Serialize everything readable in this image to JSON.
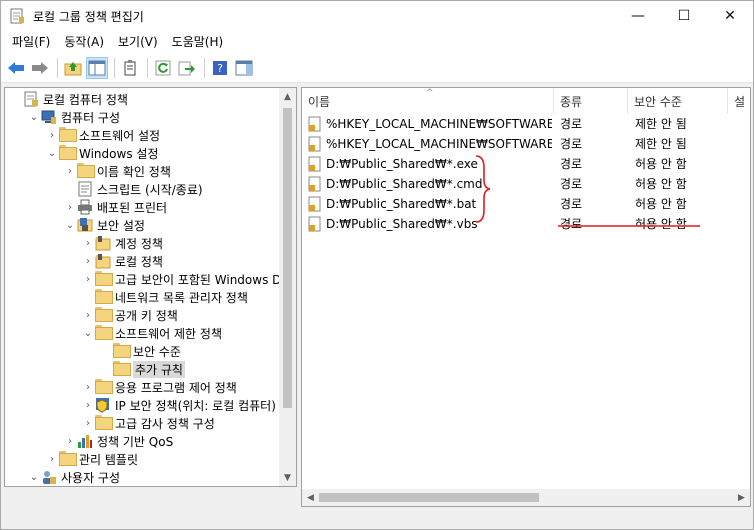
{
  "window": {
    "title": "로컬 그룹 정책 편집기",
    "controls": {
      "minimize": "—",
      "maximize": "☐",
      "close": "✕"
    }
  },
  "menu": [
    "파일(F)",
    "동작(A)",
    "보기(V)",
    "도움말(H)"
  ],
  "toolbar": [
    "back-icon",
    "forward-icon",
    "up-folder-icon",
    "show-hide-tree-icon",
    "properties-icon",
    "refresh-icon",
    "export-list-icon",
    "help-icon",
    "show-action-pane-icon"
  ],
  "tree": [
    {
      "label": "로컬 컴퓨터 정책",
      "depth": 0,
      "arrow": "",
      "icon": "policy-icon"
    },
    {
      "label": "컴퓨터 구성",
      "depth": 1,
      "arrow": "v",
      "icon": "computer-icon"
    },
    {
      "label": "소프트웨어 설정",
      "depth": 2,
      "arrow": ">",
      "icon": "folder-icon"
    },
    {
      "label": "Windows 설정",
      "depth": 2,
      "arrow": "v",
      "icon": "folder-icon"
    },
    {
      "label": "이름 확인 정책",
      "depth": 3,
      "arrow": ">",
      "icon": "folder-icon"
    },
    {
      "label": "스크립트 (시작/종료)",
      "depth": 3,
      "arrow": "",
      "icon": "script-icon"
    },
    {
      "label": "배포된 프린터",
      "depth": 3,
      "arrow": ">",
      "icon": "printer-icon"
    },
    {
      "label": "보안 설정",
      "depth": 3,
      "arrow": "v",
      "icon": "security-icon"
    },
    {
      "label": "계정 정책",
      "depth": 4,
      "arrow": ">",
      "icon": "locked-folder-icon"
    },
    {
      "label": "로컬 정책",
      "depth": 4,
      "arrow": ">",
      "icon": "locked-folder-icon"
    },
    {
      "label": "고급 보안이 포함된 Windows Defender 방화벽",
      "depth": 4,
      "arrow": ">",
      "icon": "folder-icon"
    },
    {
      "label": "네트워크 목록 관리자 정책",
      "depth": 4,
      "arrow": "",
      "icon": "folder-icon"
    },
    {
      "label": "공개 키 정책",
      "depth": 4,
      "arrow": ">",
      "icon": "folder-icon"
    },
    {
      "label": "소프트웨어 제한 정책",
      "depth": 4,
      "arrow": "v",
      "icon": "folder-icon"
    },
    {
      "label": "보안 수준",
      "depth": 5,
      "arrow": "",
      "icon": "folder-icon"
    },
    {
      "label": "추가 규칙",
      "depth": 5,
      "arrow": "",
      "icon": "open-folder-icon",
      "selected": true
    },
    {
      "label": "응용 프로그램 제어 정책",
      "depth": 4,
      "arrow": ">",
      "icon": "folder-icon"
    },
    {
      "label": "IP 보안 정책(위치: 로컬 컴퓨터)",
      "depth": 4,
      "arrow": ">",
      "icon": "ip-security-icon"
    },
    {
      "label": "고급 감사 정책 구성",
      "depth": 4,
      "arrow": ">",
      "icon": "folder-icon"
    },
    {
      "label": "정책 기반 QoS",
      "depth": 3,
      "arrow": ">",
      "icon": "qos-chart-icon"
    },
    {
      "label": "관리 템플릿",
      "depth": 2,
      "arrow": ">",
      "icon": "folder-icon"
    },
    {
      "label": "사용자 구성",
      "depth": 1,
      "arrow": "v",
      "icon": "user-icon"
    }
  ],
  "list": {
    "columns": [
      "이름",
      "종류",
      "보안 수준",
      "설"
    ],
    "rows": [
      {
        "name": "%HKEY_LOCAL_MACHINE₩SOFTWARE...",
        "type": "경로",
        "level": "제한 안 됨"
      },
      {
        "name": "%HKEY_LOCAL_MACHINE₩SOFTWARE...",
        "type": "경로",
        "level": "제한 안 됨"
      },
      {
        "name": "D:₩Public_Shared₩*.exe",
        "type": "경로",
        "level": "허용 안 함"
      },
      {
        "name": "D:₩Public_Shared₩*.cmd",
        "type": "경로",
        "level": "허용 안 함"
      },
      {
        "name": "D:₩Public_Shared₩*.bat",
        "type": "경로",
        "level": "허용 안 함"
      },
      {
        "name": "D:₩Public_Shared₩*.vbs",
        "type": "경로",
        "level": "허용 안 함"
      }
    ]
  },
  "colors": {
    "annotation": "#e01c1c",
    "selection": "#d9d9d9",
    "accent": "#1e73d8"
  }
}
